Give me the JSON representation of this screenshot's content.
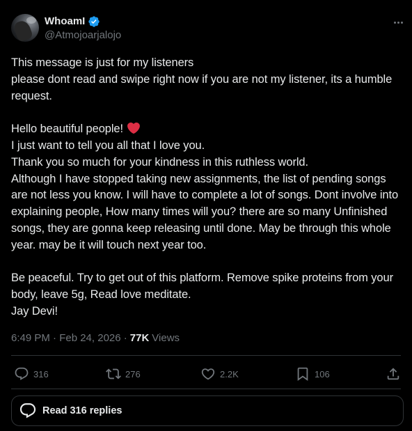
{
  "author": {
    "display_name": "WhoamI",
    "handle": "@Atmojoarjalojo",
    "verified": true
  },
  "post": {
    "lines": [
      "This message is just for my listeners",
      "please dont read and swipe right now if you are not my listener, its a humble request.",
      "",
      "Hello beautiful people!",
      "I just want to tell you all that I love you.",
      "Thank you so much for your kindness in this ruthless world.",
      "Although I have stopped taking new assignments, the list of pending songs are not less you know. I will have to complete a lot of songs. Dont involve into explaining people, How many times will you? there are so many Unfinished songs, they are gonna keep releasing until done. May be through this whole year. may be it will touch next year too.",
      "",
      "Be peaceful. Try to get out of this platform. Remove spike proteins from your body, leave 5g, Read love meditate.",
      "Jay Devi!"
    ],
    "emoji_after_line_3": "red-heart"
  },
  "meta": {
    "timestamp": "6:49 PM · Feb 24, 2026 ·",
    "views_count": "77K",
    "views_label": "Views"
  },
  "actions": {
    "replies": "316",
    "reposts": "276",
    "likes": "2.2K",
    "bookmarks": "106"
  },
  "read_replies": {
    "label": "Read 316 replies"
  },
  "colors": {
    "background": "#000000",
    "text_primary": "#e7e9ea",
    "text_secondary": "#71767b",
    "divider": "#2f3336",
    "verified": "#1d9bf0",
    "heart": "#f91880"
  },
  "icons": {
    "verified": "verified-badge-icon",
    "more": "more-horizontal-icon",
    "reply": "reply-icon",
    "repost": "repost-icon",
    "like": "like-heart-icon",
    "bookmark": "bookmark-icon",
    "share": "share-icon"
  }
}
